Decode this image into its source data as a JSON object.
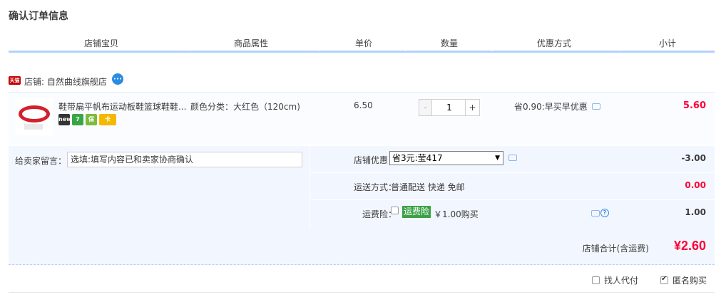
{
  "page": {
    "title": "确认订单信息"
  },
  "columns": [
    "店铺宝贝",
    "商品属性",
    "单价",
    "数量",
    "优惠方式",
    "小计"
  ],
  "shop": {
    "badge": "天猫",
    "label": "店铺: 自然曲线旗舰店"
  },
  "item": {
    "title": "鞋带扁平帆布运动板鞋篮球鞋鞋...",
    "badges": [
      "new",
      "7",
      "保",
      "卡"
    ],
    "attr": "颜色分类：大红色（120cm)",
    "price": "6.50",
    "quantity_minus": "-",
    "quantity": "1",
    "quantity_plus": "+",
    "promo": "省0.90:早买早优惠",
    "subtotal": "5.60"
  },
  "note": {
    "label": "给卖家留言：",
    "placeholder": "选填:填写内容已和卖家协商确认"
  },
  "coupon": {
    "label": "店铺优惠：",
    "selected": "省3元:莹417",
    "amount": "-3.00"
  },
  "shipping": {
    "label": "运送方式：",
    "text": "普通配送 快递 免邮",
    "amount": "0.00"
  },
  "insurance": {
    "label": "运费险：",
    "tag": "运费险",
    "price": "￥1.00购买",
    "amount": "1.00",
    "checked": false
  },
  "total": {
    "label": "店铺合计(含运费)",
    "amount": "¥2.60"
  },
  "options": {
    "proxy_label": "找人代付",
    "proxy_checked": false,
    "anonymous_label": "匿名购买",
    "anonymous_checked": true
  },
  "colors": {
    "accent_blue": "#b2d1ff",
    "price_red": "#ff0036",
    "panel_bg": "#f2f7ff"
  }
}
